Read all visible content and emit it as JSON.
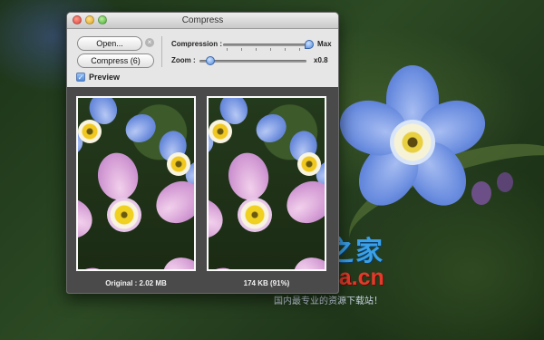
{
  "window": {
    "title": "Compress"
  },
  "buttons": {
    "open": "Open...",
    "compress": "Compress (6)"
  },
  "preview": {
    "label": "Preview",
    "checked": true
  },
  "compression": {
    "label": "Compression :",
    "value_label": "Max",
    "level": 1.0
  },
  "zoom": {
    "label": "Zoom :",
    "value_label": "x0.8",
    "level": 0.1
  },
  "images": {
    "original_caption": "Original : 2.02 MB",
    "compressed_caption": "174 KB (91%)"
  },
  "watermark": {
    "site_cn": "下载之家",
    "site_en": "downza.cn",
    "tagline": "国内最专业的资源下载站！"
  },
  "colors": {
    "accent": "#4d8ade",
    "watermark_blue": "#3aa0e8",
    "watermark_red": "#e23b2b"
  }
}
